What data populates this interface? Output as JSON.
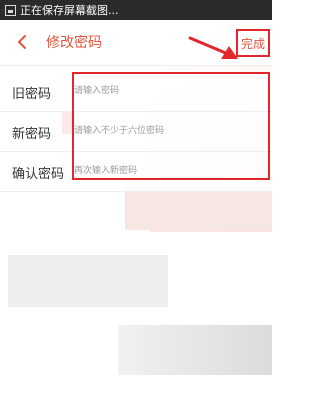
{
  "status_bar": {
    "text": "正在保存屏幕截图..."
  },
  "header": {
    "title": "修改密码",
    "done_label": "完成"
  },
  "form": {
    "rows": [
      {
        "label": "旧密码",
        "placeholder": "请输入密码"
      },
      {
        "label": "新密码",
        "placeholder": "请输入不少于六位密码"
      },
      {
        "label": "确认密码",
        "placeholder": "再次输入新密码"
      }
    ]
  },
  "colors": {
    "accent": "#e4553f",
    "annotation": "#e3262b",
    "status_bar": "#2b2b2b"
  },
  "icons": [
    "screenshot-icon",
    "back-arrow-icon",
    "annotation-arrow-icon"
  ]
}
